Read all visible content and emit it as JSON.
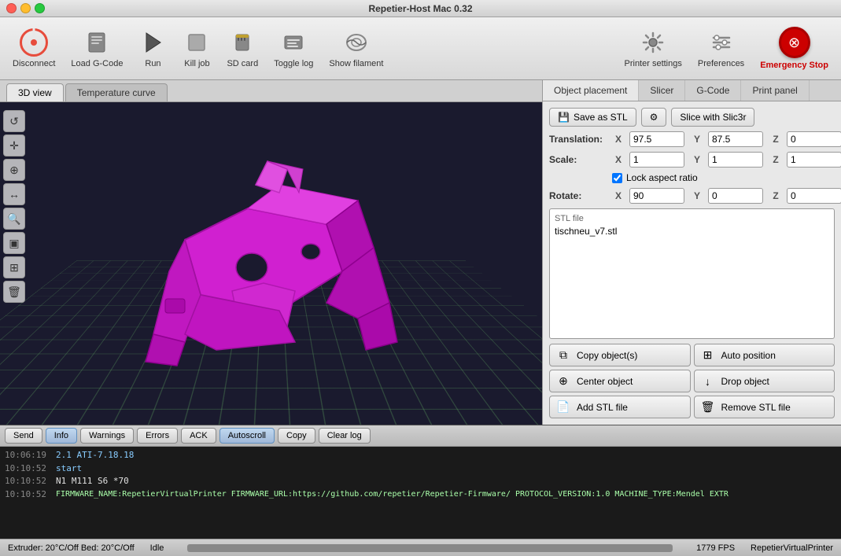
{
  "titlebar": {
    "title": "Repetier-Host Mac 0.32"
  },
  "toolbar": {
    "disconnect_label": "Disconnect",
    "load_gcode_label": "Load G-Code",
    "run_label": "Run",
    "kill_job_label": "Kill job",
    "sd_card_label": "SD card",
    "toggle_log_label": "Toggle log",
    "show_filament_label": "Show filament",
    "printer_settings_label": "Printer settings",
    "preferences_label": "Preferences",
    "emergency_stop_label": "Emergency Stop"
  },
  "view_tabs": {
    "tab1": "3D view",
    "tab2": "Temperature curve"
  },
  "panel_tabs": {
    "tab1": "Object placement",
    "tab2": "Slicer",
    "tab3": "G-Code",
    "tab4": "Print panel"
  },
  "save_stl_label": "Save as STL",
  "slice_label": "Slice with Slic3r",
  "translation": {
    "label": "Translation:",
    "x_val": "97.5",
    "y_val": "87.5",
    "z_val": "0"
  },
  "scale": {
    "label": "Scale:",
    "x_val": "1",
    "y_val": "1",
    "z_val": "1"
  },
  "lock_aspect": "Lock aspect ratio",
  "rotate": {
    "label": "Rotate:",
    "x_val": "90",
    "y_val": "0",
    "z_val": "0"
  },
  "stl_file": {
    "label": "STL file",
    "name": "tischneu_v7.stl"
  },
  "actions": {
    "copy_objects": "Copy object(s)",
    "auto_position": "Auto position",
    "center_object": "Center object",
    "drop_object": "Drop object",
    "add_stl": "Add STL file",
    "remove_stl": "Remove STL file"
  },
  "log_toolbar": {
    "send_label": "Send",
    "info_label": "Info",
    "warnings_label": "Warnings",
    "errors_label": "Errors",
    "ack_label": "ACK",
    "autoscroll_label": "Autoscroll",
    "copy_label": "Copy",
    "clear_label": "Clear log"
  },
  "log_lines": [
    {
      "time": "10:06:19",
      "msg": "2.1 ATI-7.18.18",
      "type": "highlight"
    },
    {
      "time": "10:10:52",
      "msg": "start",
      "type": "highlight"
    },
    {
      "time": "10:10:52",
      "msg": "N1 M111 S6 *70",
      "type": "normal"
    },
    {
      "time": "10:10:52",
      "msg": "FIRMWARE_NAME:RepetierVirtualPrinter FIRMWARE_URL:https://github.com/repetier/Repetier-Firmware/ PROTOCOL_VERSION:1.0 MACHINE_TYPE:Mendel EXTR",
      "type": "firmware"
    }
  ],
  "statusbar": {
    "temp": "Extruder: 20°C/Off Bed: 20°C/Off",
    "idle": "Idle",
    "fps": "1779 FPS",
    "printer": "RepetierVirtualPrinter"
  }
}
